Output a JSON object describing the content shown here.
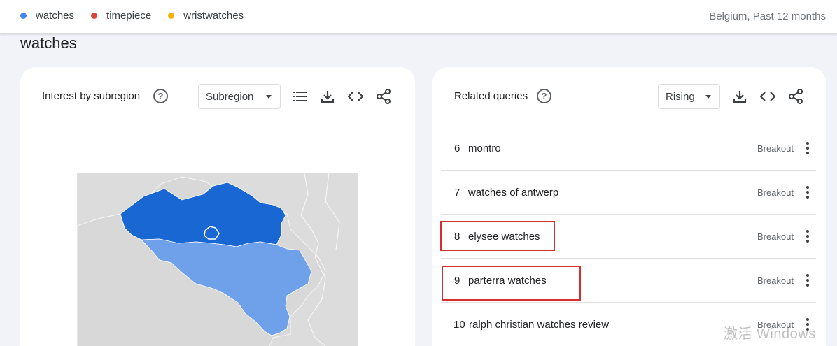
{
  "legend": [
    {
      "label": "watches",
      "color": "#4285f4"
    },
    {
      "label": "timepiece",
      "color": "#db4437"
    },
    {
      "label": "wristwatches",
      "color": "#f4b400"
    }
  ],
  "region_time": "Belgium, Past 12 months",
  "page_title": "watches",
  "subregion_card": {
    "title": "Interest by subregion",
    "help_icon": "?",
    "select_value": "Subregion",
    "map_colors": {
      "dark": "#1967d2",
      "light": "#6fa1ea",
      "neutral": "#dcdcdc"
    }
  },
  "queries_card": {
    "title": "Related queries",
    "help_icon": "?",
    "select_value": "Rising",
    "rows": [
      {
        "rank": "6",
        "query": "montro",
        "badge": "Breakout"
      },
      {
        "rank": "7",
        "query": "watches of antwerp",
        "badge": "Breakout"
      },
      {
        "rank": "8",
        "query": "elysee watches",
        "badge": "Breakout"
      },
      {
        "rank": "9",
        "query": "parterra watches",
        "badge": "Breakout"
      },
      {
        "rank": "10",
        "query": "ralph christian watches review",
        "badge": "Breakout"
      }
    ]
  },
  "watermark": "激活 Windows"
}
